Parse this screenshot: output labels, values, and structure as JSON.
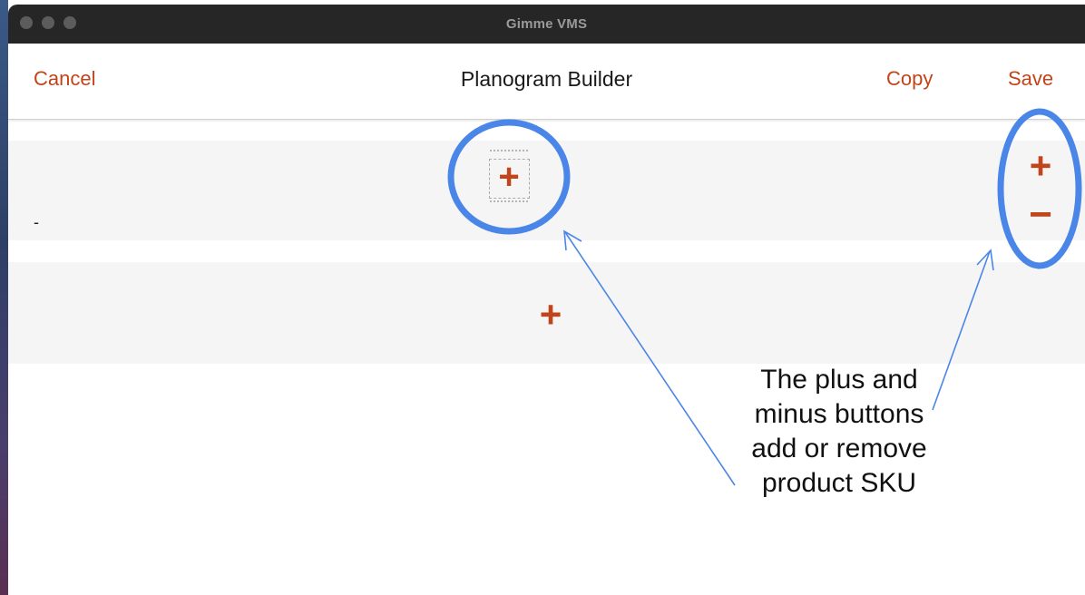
{
  "window": {
    "title": "Gimme VMS"
  },
  "navbar": {
    "cancel_label": "Cancel",
    "title": "Planogram Builder",
    "copy_label": "Copy",
    "save_label": "Save"
  },
  "rows": [
    {
      "slot_plus": "+",
      "label": "-",
      "add_label": "+",
      "remove_label": "−"
    },
    {
      "add_label": "+"
    }
  ],
  "annotation": {
    "lines": [
      "The plus and",
      "minus buttons",
      "add or remove",
      "product SKU"
    ]
  },
  "colors": {
    "accent": "#c2441a",
    "annotation": "#4a86e8",
    "titlebar": "#262626"
  }
}
